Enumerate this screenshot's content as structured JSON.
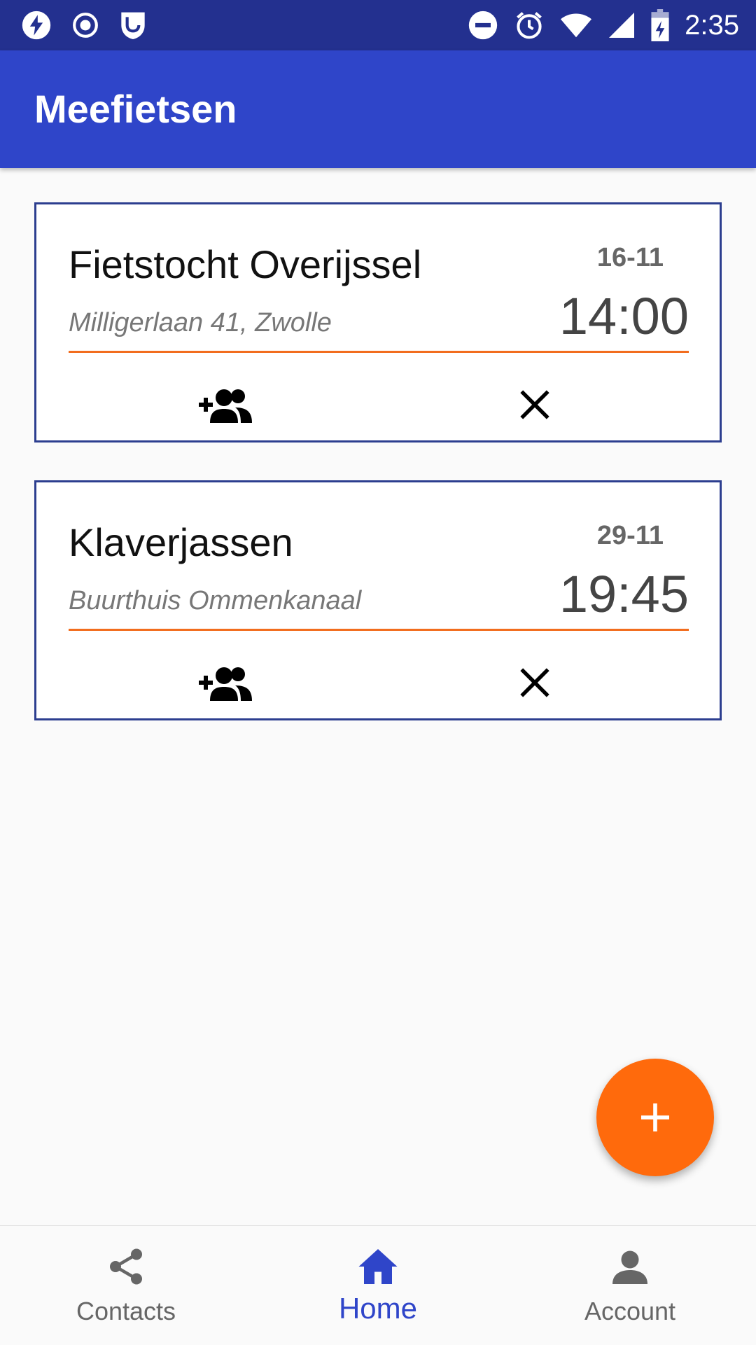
{
  "status_bar": {
    "time": "2:35",
    "icons_left": [
      "flash-icon",
      "record-icon",
      "shield-icon"
    ],
    "icons_right": [
      "do-not-disturb-icon",
      "alarm-icon",
      "wifi-icon",
      "signal-icon",
      "battery-charging-icon"
    ]
  },
  "app_bar": {
    "title": "Meefietsen"
  },
  "events": [
    {
      "title": "Fietstocht Overijssel",
      "location": "Milligerlaan 41, Zwolle",
      "date": "16-11",
      "time": "14:00",
      "actions": [
        "group-add-icon",
        "close-icon"
      ]
    },
    {
      "title": "Klaverjassen",
      "location": "Buurthuis Ommenkanaal",
      "date": "29-11",
      "time": "19:45",
      "actions": [
        "group-add-icon",
        "close-icon"
      ]
    }
  ],
  "fab": {
    "icon": "add-icon"
  },
  "bottom_nav": {
    "items": [
      {
        "label": "Contacts",
        "icon": "share-icon",
        "active": false
      },
      {
        "label": "Home",
        "icon": "home-icon",
        "active": true
      },
      {
        "label": "Account",
        "icon": "person-icon",
        "active": false
      }
    ]
  },
  "colors": {
    "status_bar": "#23308f",
    "app_bar": "#2f45c9",
    "accent": "#ff6a0c",
    "divider": "#f26d1e",
    "card_border": "#2c3e8f",
    "nav_active": "#2f45c9",
    "nav_inactive": "#666666"
  }
}
